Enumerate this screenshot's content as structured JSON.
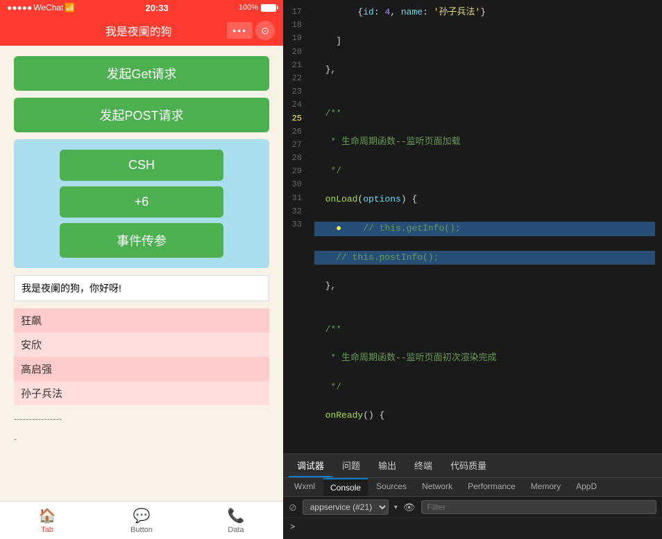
{
  "phone": {
    "status_bar": {
      "provider": "WeChat",
      "signal_icon": "●●●●●",
      "time": "20:33",
      "battery_percent": "100%"
    },
    "title_bar": {
      "title": "我是夜阑的狗",
      "dots_label": "•••",
      "record_icon": "⊙"
    },
    "buttons": {
      "get_request": "发起Get请求",
      "post_request": "发起POST请求",
      "csh": "CSH",
      "plus6": "+6",
      "event_param": "事件传参"
    },
    "text_output": "我是夜阑的狗，你好呀!",
    "list_items": [
      "狂飙",
      "安欣",
      "高启强",
      "孙子兵法"
    ],
    "divider": "----------------",
    "divider2": "-"
  },
  "tab_bar": {
    "items": [
      {
        "label": "Tab",
        "icon": "🏠"
      },
      {
        "label": "Button",
        "icon": "💬"
      },
      {
        "label": "Data",
        "icon": "📞"
      }
    ],
    "active_index": 0
  },
  "code": {
    "lines": [
      {
        "num": "17",
        "text": "        {id: 4, name: '孙子兵法'}"
      },
      {
        "num": "18",
        "text": "    ]"
      },
      {
        "num": "19",
        "text": "  },"
      },
      {
        "num": "20",
        "text": ""
      },
      {
        "num": "21",
        "text": "  /**"
      },
      {
        "num": "22",
        "text": "   * 生命周期函数--监听页面加载"
      },
      {
        "num": "23",
        "text": "   */"
      },
      {
        "num": "24",
        "text": "  onLoad(options) {"
      },
      {
        "num": "25",
        "text": "    // this.getInfo();"
      },
      {
        "num": "26",
        "text": "    // this.postInfo();"
      },
      {
        "num": "27",
        "text": "  },"
      },
      {
        "num": "28",
        "text": ""
      },
      {
        "num": "29",
        "text": "  /**"
      },
      {
        "num": "30",
        "text": "   * 生命周期函数--监听页面初次渲染完成"
      },
      {
        "num": "31",
        "text": "   */"
      },
      {
        "num": "32",
        "text": "  onReady() {"
      },
      {
        "num": "33",
        "text": ""
      }
    ]
  },
  "devtools_tabs": {
    "row1": [
      "调试器",
      "问题",
      "输出",
      "终端",
      "代码质量"
    ],
    "row1_active": "调试器",
    "row2": [
      "Wxml",
      "Console",
      "Sources",
      "Network",
      "Performance",
      "Memory",
      "AppD"
    ],
    "row2_active": "Console"
  },
  "console": {
    "appservice_label": "appservice (#21)",
    "filter_placeholder": "Filter",
    "cursor": ">"
  },
  "colors": {
    "red": "#ff3b30",
    "green": "#4caf50",
    "blue_bg": "#aaddee",
    "highlight": "#264f78"
  }
}
